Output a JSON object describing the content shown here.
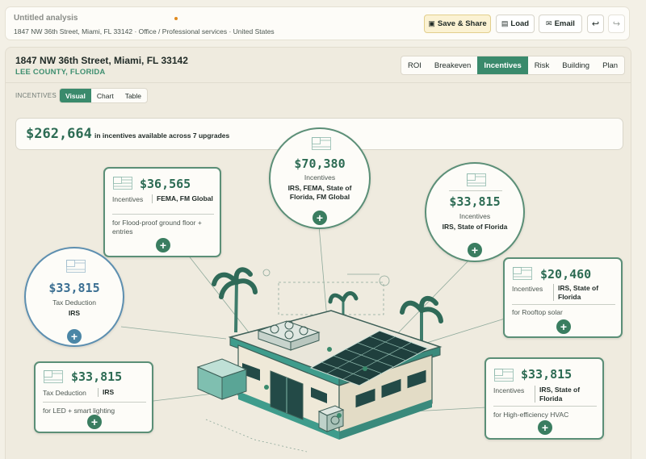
{
  "header": {
    "title": "Untitled analysis",
    "subtitle": "1847 NW 36th Street, Miami, FL 33142 · Office / Professional services · United States",
    "buttons": {
      "save": "Save & Share",
      "load": "Load",
      "email": "Email",
      "undo": "↩",
      "redo": "↪"
    }
  },
  "property": {
    "address": "1847 NW 36th Street, Miami, FL 33142",
    "county": "LEE COUNTY, FLORIDA"
  },
  "tabs": [
    "ROI",
    "Breakeven",
    "Incentives",
    "Risk",
    "Building",
    "Plan"
  ],
  "active_tab": "Incentives",
  "incentives_view": {
    "label": "INCENTIVES",
    "options": [
      "Visual",
      "Chart",
      "Table"
    ],
    "active": "Visual"
  },
  "summary": {
    "total": "$262,664",
    "text": "in incentives available across 7 upgrades"
  },
  "cards": {
    "flood": {
      "amount": "$36,565",
      "kind": "Incentives",
      "providers": "FEMA, FM Global",
      "description": "for Flood-proof ground floor + entries"
    },
    "roof_main": {
      "amount": "$70,380",
      "kind": "Incentives",
      "providers": "IRS, FEMA, State of Florida, FM Global"
    },
    "right_circle": {
      "amount": "$33,815",
      "kind": "Incentives",
      "providers": "IRS, State of Florida"
    },
    "left_circle": {
      "amount": "$33,815",
      "kind": "Tax Deduction",
      "providers": "IRS"
    },
    "solar": {
      "amount": "$20,460",
      "kind": "Incentives",
      "providers": "IRS, State of Florida",
      "description": "for Rooftop solar"
    },
    "lighting": {
      "amount": "$33,815",
      "kind": "Tax Deduction",
      "providers": "IRS",
      "description": "for LED + smart lighting"
    },
    "hvac": {
      "amount": "$33,815",
      "kind": "Incentives",
      "providers": "IRS, State of Florida",
      "description": "for High-efficiency HVAC"
    }
  },
  "colors": {
    "accent": "#3a8a6c",
    "amount": "#2c6b53",
    "blue_accent": "#4b86a6",
    "background": "#f3f0e6"
  },
  "icons": {
    "flag": "us-flag-icon",
    "add": "plus-icon",
    "save": "floppy-icon",
    "load": "folder-icon",
    "email": "envelope-icon"
  }
}
